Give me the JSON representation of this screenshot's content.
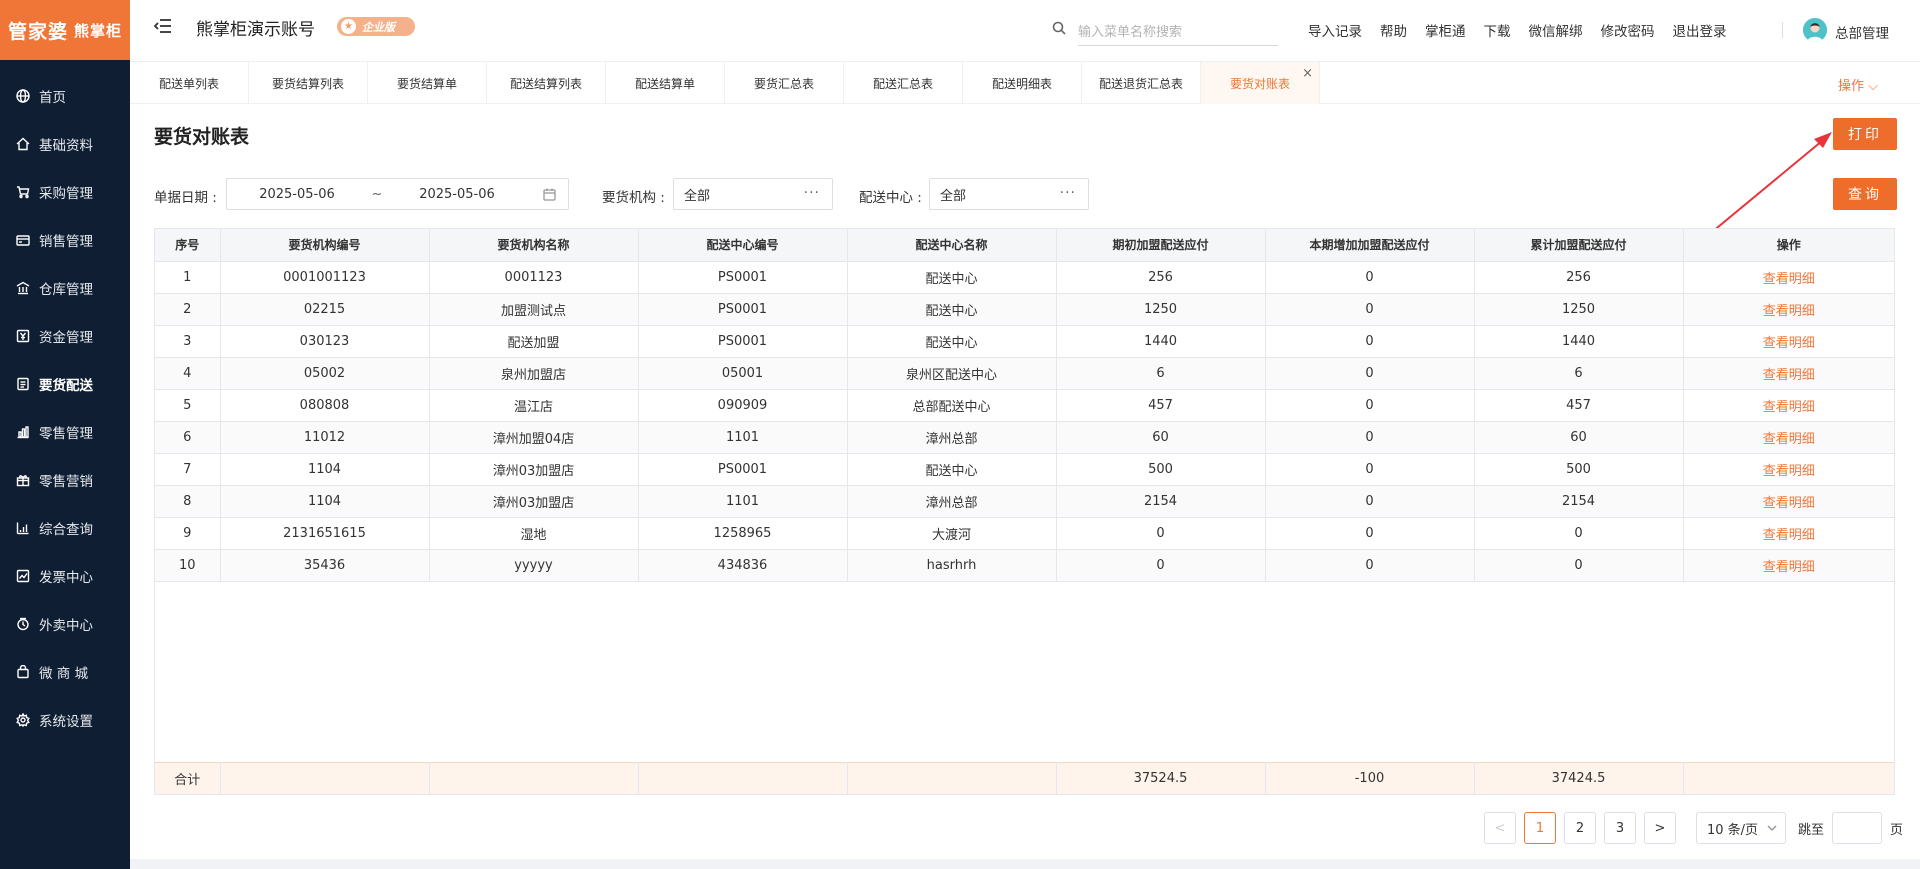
{
  "logo": {
    "main": "管家婆",
    "sub": "熊掌柜"
  },
  "sidebar": {
    "items": [
      {
        "label": "首页",
        "icon": "globe-icon"
      },
      {
        "label": "基础资料",
        "icon": "home-icon"
      },
      {
        "label": "采购管理",
        "icon": "cart-icon"
      },
      {
        "label": "销售管理",
        "icon": "wallet-icon"
      },
      {
        "label": "仓库管理",
        "icon": "warehouse-icon"
      },
      {
        "label": "资金管理",
        "icon": "yen-icon"
      },
      {
        "label": "要货配送",
        "icon": "list-icon",
        "active": true
      },
      {
        "label": "零售管理",
        "icon": "bar-chart-icon"
      },
      {
        "label": "零售营销",
        "icon": "gift-icon"
      },
      {
        "label": "综合查询",
        "icon": "chart-icon"
      },
      {
        "label": "发票中心",
        "icon": "trend-icon"
      },
      {
        "label": "外卖中心",
        "icon": "clock-icon"
      },
      {
        "label": "微 商 城",
        "icon": "bag-icon"
      },
      {
        "label": "系统设置",
        "icon": "gear-icon"
      }
    ]
  },
  "header": {
    "account_name": "熊掌柜演示账号",
    "badge": "企业版",
    "search_placeholder": "输入菜单名称搜索",
    "links": [
      "导入记录",
      "帮助",
      "掌柜通",
      "下载",
      "微信解绑",
      "修改密码",
      "退出登录"
    ],
    "user_name": "总部管理"
  },
  "tabs": [
    "配送单列表",
    "要货结算列表",
    "要货结算单",
    "配送结算列表",
    "配送结算单",
    "要货汇总表",
    "配送汇总表",
    "配送明细表",
    "配送退货汇总表",
    "要货对账表"
  ],
  "ops_label": "操作 ⌵",
  "page": {
    "title": "要货对账表",
    "print_label": "打印",
    "query_label": "查询"
  },
  "filters": {
    "date_label": "单据日期 :",
    "date_start": "2025-05-06",
    "date_sep": "~",
    "date_end": "2025-05-06",
    "org_label": "要货机构 :",
    "org_value": "全部",
    "center_label": "配送中心 :",
    "center_value": "全部"
  },
  "table": {
    "headers": [
      "序号",
      "要货机构编号",
      "要货机构名称",
      "配送中心编号",
      "配送中心名称",
      "期初加盟配送应付",
      "本期增加加盟配送应付",
      "累计加盟配送应付",
      "操作"
    ],
    "rows": [
      [
        "1",
        "0001001123",
        "0001123",
        "PS0001",
        "配送中心",
        "256",
        "0",
        "256",
        "查看明细"
      ],
      [
        "2",
        "02215",
        "加盟测试点",
        "PS0001",
        "配送中心",
        "1250",
        "0",
        "1250",
        "查看明细"
      ],
      [
        "3",
        "030123",
        "配送加盟",
        "PS0001",
        "配送中心",
        "1440",
        "0",
        "1440",
        "查看明细"
      ],
      [
        "4",
        "05002",
        "泉州加盟店",
        "05001",
        "泉州区配送中心",
        "6",
        "0",
        "6",
        "查看明细"
      ],
      [
        "5",
        "080808",
        "温江店",
        "090909",
        "总部配送中心",
        "457",
        "0",
        "457",
        "查看明细"
      ],
      [
        "6",
        "11012",
        "漳州加盟04店",
        "1101",
        "漳州总部",
        "60",
        "0",
        "60",
        "查看明细"
      ],
      [
        "7",
        "1104",
        "漳州03加盟店",
        "PS0001",
        "配送中心",
        "500",
        "0",
        "500",
        "查看明细"
      ],
      [
        "8",
        "1104",
        "漳州03加盟店",
        "1101",
        "漳州总部",
        "2154",
        "0",
        "2154",
        "查看明细"
      ],
      [
        "9",
        "2131651615",
        "湿地",
        "1258965",
        "大渡河",
        "0",
        "0",
        "0",
        "查看明细"
      ],
      [
        "10",
        "35436",
        "yyyyy",
        "434836",
        "hasrhrh",
        "0",
        "0",
        "0",
        "查看明细"
      ]
    ],
    "totals": [
      "合计",
      "",
      "",
      "",
      "",
      "37524.5",
      "-100",
      "37424.5",
      ""
    ]
  },
  "pagination": {
    "prev": "<",
    "pages": [
      "1",
      "2",
      "3"
    ],
    "current": "1",
    "next": ">",
    "page_size": "10 条/页",
    "jump_label": "跳至",
    "page_unit": "页"
  },
  "colors": {
    "accent": "#ef7636",
    "sidebar": "#0f1e33"
  }
}
